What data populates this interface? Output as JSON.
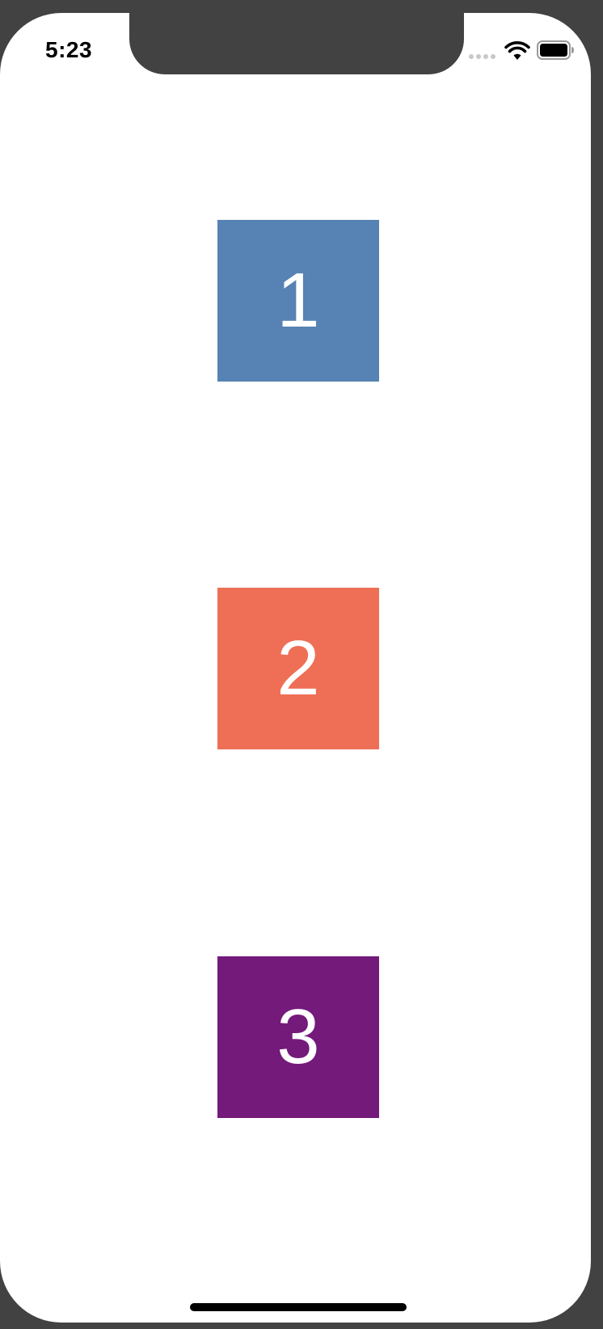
{
  "status_bar": {
    "time": "5:23",
    "signal_icon": "cellular-dots-icon",
    "wifi_icon": "wifi-icon",
    "battery_icon": "battery-icon"
  },
  "tiles": [
    {
      "label": "1",
      "color": "#5683B3"
    },
    {
      "label": "2",
      "color": "#EE6F55"
    },
    {
      "label": "3",
      "color": "#731A7A"
    }
  ],
  "home_indicator_icon": "home-indicator"
}
